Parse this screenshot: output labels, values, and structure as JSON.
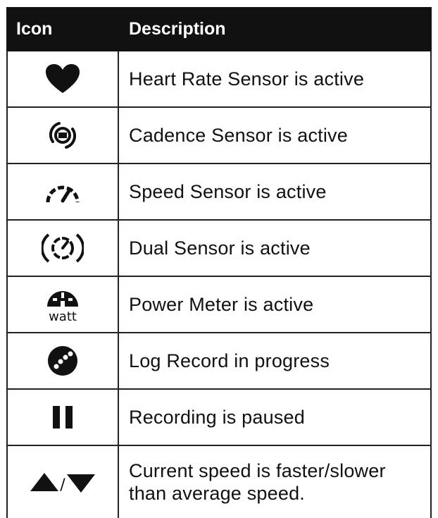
{
  "header": {
    "col_icon": "Icon",
    "col_description": "Description"
  },
  "rows": [
    {
      "icon": "heart-icon",
      "description": "Heart Rate Sensor is active"
    },
    {
      "icon": "cadence-sensor-icon",
      "description": "Cadence Sensor is active"
    },
    {
      "icon": "speed-sensor-icon",
      "description": "Speed Sensor is active"
    },
    {
      "icon": "dual-sensor-icon",
      "description": "Dual Sensor is active"
    },
    {
      "icon": "power-meter-icon",
      "icon_text": "watt",
      "description": "Power Meter is active"
    },
    {
      "icon": "log-record-icon",
      "description": "Log Record in progress"
    },
    {
      "icon": "pause-icon",
      "description": "Recording is paused"
    },
    {
      "icon": "faster-slower-icon",
      "icon_text": "/",
      "description_lines": [
        "Current speed is faster/slower",
        "than average speed."
      ]
    }
  ]
}
